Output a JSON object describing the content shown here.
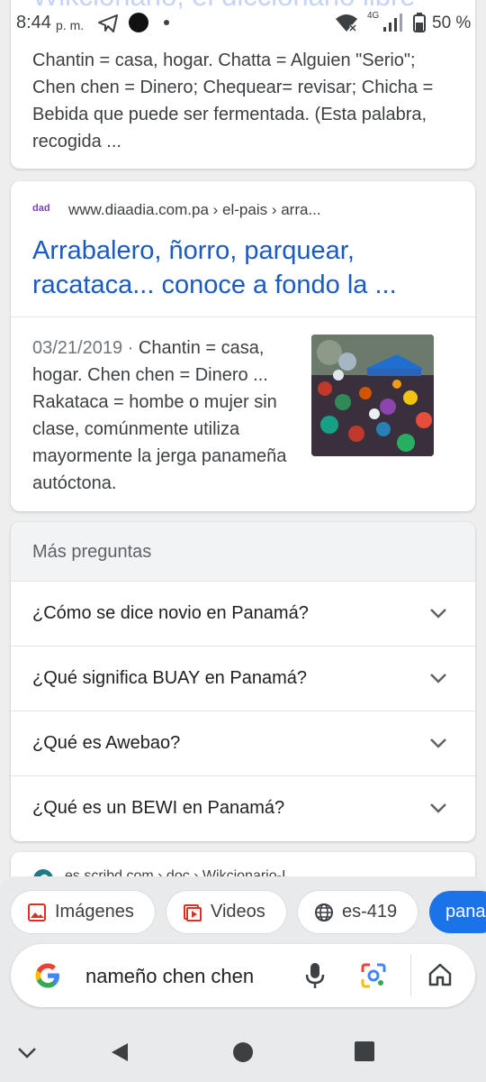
{
  "status_bar": {
    "time": "8:44",
    "ampm": "p. m.",
    "network": "4G",
    "battery": "50 %",
    "peek_text": "Wikcionario, el diccionario libre"
  },
  "result_top": {
    "snippet": "Chantin = casa, hogar. Chatta = Alguien \"Serio\"; Chen chen = Dinero; Chequear= revisar; Chicha = Bebida que puede ser fermentada. (Esta palabra, recogida ..."
  },
  "result_main": {
    "favicon_text": "dad",
    "breadcrumb": "www.diaadia.com.pa › el-pais › arra...",
    "title": "Arrabalero, ñorro, parquear, racataca... conoce a fondo la ...",
    "date": "03/21/2019",
    "snippet": "Chantin = casa, hogar. Chen chen = Dinero ... Rakataca = hombe o mujer sin clase, comúnmente utiliza mayormente la jerga panameña autóctona."
  },
  "more_questions": {
    "header": "Más preguntas",
    "items": [
      "¿Cómo se dice novio en Panamá?",
      "¿Qué significa BUAY en Panamá?",
      "¿Qué es Awebao?",
      "¿Qué es un BEWI en Panamá?"
    ]
  },
  "next_result": {
    "breadcrumb": "es.scribd.com › doc › Wikcionario-I..."
  },
  "chips": {
    "images": "Imágenes",
    "videos": "Videos",
    "language": "es-419",
    "partial": "pana"
  },
  "search": {
    "query": "nameño chen chen"
  },
  "colors": {
    "link": "#1a5bbf",
    "accent": "#1a73e8"
  }
}
